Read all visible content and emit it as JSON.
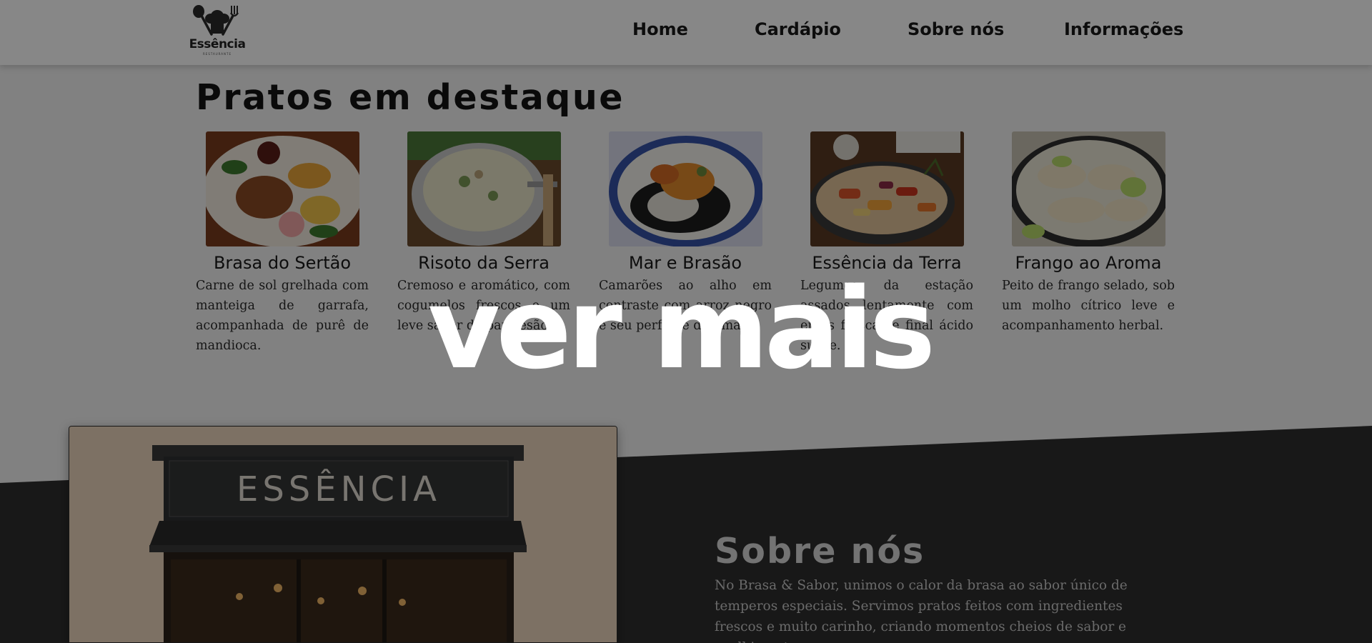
{
  "header": {
    "logo": {
      "word": "Essência",
      "sub": "RESTAURANTE"
    },
    "nav": [
      "Home",
      "Cardápio",
      "Sobre nós",
      "Informações"
    ]
  },
  "featured": {
    "title": "Pratos em destaque",
    "dishes": [
      {
        "name": "Brasa do Sertão",
        "description": "Carne de sol grelhada com manteiga de garrafa, acompanhada de purê de mandioca."
      },
      {
        "name": "Risoto da Serra",
        "description": "Cremoso e aromático, com cogumelos frescos e um leve sabor de parmesão."
      },
      {
        "name": "Mar e Brasão",
        "description": "Camarões ao alho em contraste com arroz negro e seu perfume defumado."
      },
      {
        "name": "Essência da Terra",
        "description": "Legumes da estação assados lentamente com ervas frescas e final ácido suave."
      },
      {
        "name": "Frango ao Aroma",
        "description": "Peito de frango selado, sob um molho cítrico leve e acompanhamento herbal."
      }
    ]
  },
  "about": {
    "sign": "ESSÊNCIA",
    "title": "Sobre nós",
    "text": "No Brasa & Sabor, unimos o calor da brasa ao sabor único de temperos especiais. Servimos pratos feitos com ingredientes frescos e muito carinho, criando momentos cheios de sabor e acolhimento."
  },
  "overlay": {
    "label": "ver mais"
  },
  "colors": {
    "overlay": "#00000078",
    "dark_band": "#2f2f2f",
    "header_bg": "#ffffff"
  }
}
